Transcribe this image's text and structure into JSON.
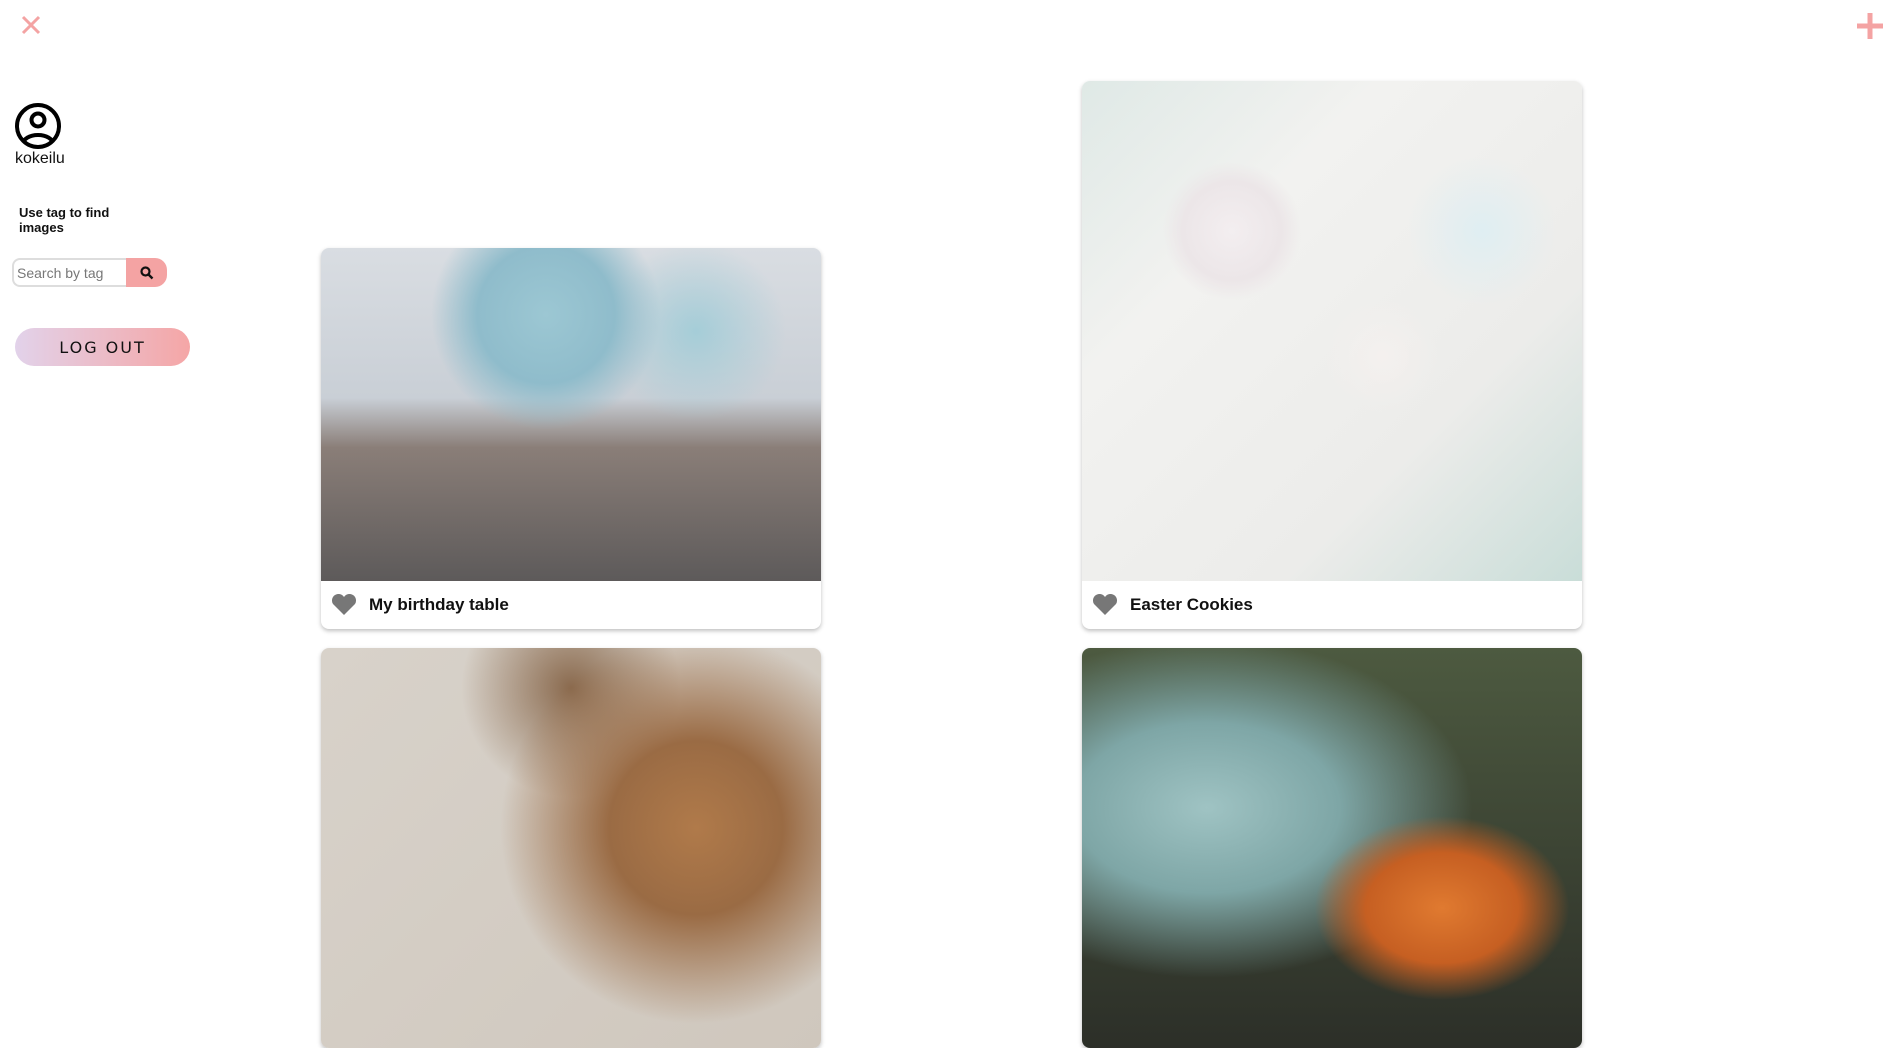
{
  "header": {
    "close_icon": "close-icon",
    "add_icon": "plus-icon",
    "accent": "#f4a3a3"
  },
  "sidebar": {
    "username": "kokeilu",
    "search_hint": "Use tag to find images",
    "search_placeholder": "Search by tag",
    "search_value": "",
    "logout_label": "LOG OUT"
  },
  "gallery": [
    {
      "title": "My birthday table"
    },
    {
      "title": "Easter Cookies"
    },
    {
      "title": ""
    },
    {
      "title": ""
    }
  ]
}
